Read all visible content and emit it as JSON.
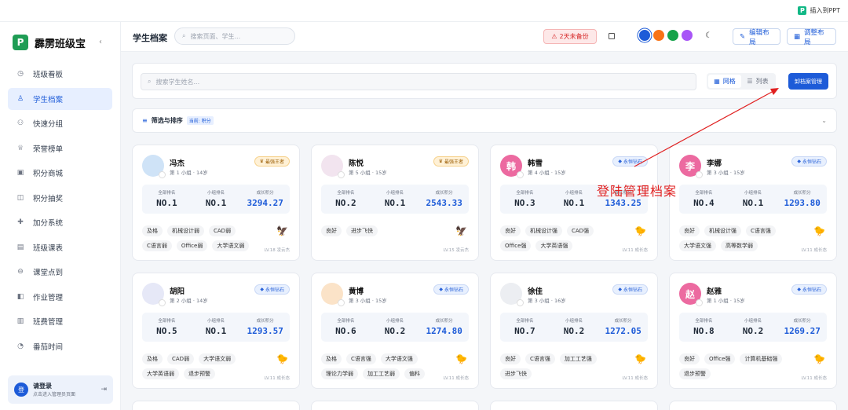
{
  "ppt": {
    "label": "插入到PPT"
  },
  "app": {
    "name": "霹雳班级宝",
    "logo_letter": "P",
    "collapse": "‹"
  },
  "nav": [
    {
      "label": "班级看板",
      "icon": "dashboard-icon",
      "glyph": "◷"
    },
    {
      "label": "学生档案",
      "icon": "user-icon",
      "glyph": "♙",
      "active": true
    },
    {
      "label": "快速分组",
      "icon": "group-icon",
      "glyph": "⚇"
    },
    {
      "label": "荣誉榜单",
      "icon": "trophy-icon",
      "glyph": "♕"
    },
    {
      "label": "积分商城",
      "icon": "shop-icon",
      "glyph": "▣"
    },
    {
      "label": "积分抽奖",
      "icon": "lottery-icon",
      "glyph": "◫"
    },
    {
      "label": "加分系统",
      "icon": "plus-icon",
      "glyph": "✚"
    },
    {
      "label": "班级课表",
      "icon": "calendar-icon",
      "glyph": "▤"
    },
    {
      "label": "课堂点到",
      "icon": "checkin-icon",
      "glyph": "⊖"
    },
    {
      "label": "作业管理",
      "icon": "book-icon",
      "glyph": "◧"
    },
    {
      "label": "班费管理",
      "icon": "wallet-icon",
      "glyph": "▥"
    },
    {
      "label": "番茄时间",
      "icon": "timer-icon",
      "glyph": "◔"
    }
  ],
  "login": {
    "avatar": "登",
    "title": "请登录",
    "sub": "点击进入管理员页面"
  },
  "header": {
    "title": "学生档案",
    "search_placeholder": "搜索页面、学生...",
    "backup": "2天未备份",
    "edit_layout": "编辑布局",
    "adjust_layout": "调整布局"
  },
  "theme_colors": [
    "#1d5bd8",
    "#f97316",
    "#16a34a",
    "#a855f7"
  ],
  "toolbar": {
    "search_placeholder": "搜索学生姓名...",
    "grid": "网格",
    "list": "列表",
    "archive_button": "卸档案管理"
  },
  "filter": {
    "label": "筛选与排序",
    "tag": "当前: 积分"
  },
  "stat_labels": [
    "全部排名",
    "小组排名",
    "成长积分"
  ],
  "annotation": "登陆管理档案",
  "students": [
    {
      "name": "冯杰",
      "sub": "第 1 小组 · 14岁",
      "badge": "最强王者",
      "badge_type": "gold",
      "avatar_color": "#cfe3f7",
      "avatar_text": "",
      "ranks": [
        "NO.1",
        "NO.1",
        "3294.27"
      ],
      "tags": [
        "及格",
        "机械设计弱",
        "CAD弱",
        "C语言弱",
        "Office弱",
        "大学语文弱"
      ],
      "mark": "🦅",
      "level": "LV.18 凌云杰"
    },
    {
      "name": "陈悦",
      "sub": "第 5 小组 · 15岁",
      "badge": "最强王者",
      "badge_type": "gold",
      "avatar_color": "#f2e4ef",
      "avatar_text": "",
      "ranks": [
        "NO.2",
        "NO.1",
        "2543.33"
      ],
      "tags": [
        "良好",
        "进步飞快"
      ],
      "mark": "🦅",
      "level": "LV.15 凌云杰"
    },
    {
      "name": "韩雪",
      "sub": "第 4 小组 · 15岁",
      "badge": "永恒钻石",
      "badge_type": "dia",
      "avatar_color": "#ec6aa0",
      "avatar_text": "韩",
      "ranks": [
        "NO.3",
        "NO.1",
        "1343.25"
      ],
      "tags": [
        "良好",
        "机械设计强",
        "CAD强",
        "Office强",
        "大学英语强"
      ],
      "mark": "🐤",
      "level": "LV.11 成长态"
    },
    {
      "name": "李娜",
      "sub": "第 3 小组 · 15岁",
      "badge": "永恒钻石",
      "badge_type": "dia",
      "avatar_color": "#ec6aa0",
      "avatar_text": "李",
      "ranks": [
        "NO.4",
        "NO.1",
        "1293.80"
      ],
      "tags": [
        "良好",
        "机械设计强",
        "C语言强",
        "大学语文强",
        "高等数学弱"
      ],
      "mark": "🐤",
      "level": "LV.11 成长态"
    },
    {
      "name": "胡阳",
      "sub": "第 2 小组 · 14岁",
      "badge": "永恒钻石",
      "badge_type": "dia",
      "avatar_color": "#e6e8f7",
      "avatar_text": "",
      "ranks": [
        "NO.5",
        "NO.1",
        "1293.57"
      ],
      "tags": [
        "及格",
        "CAD弱",
        "大学语文弱",
        "大学英语弱",
        "退步预警"
      ],
      "mark": "🐤",
      "level": "LV.11 成长态"
    },
    {
      "name": "黄博",
      "sub": "第 3 小组 · 15岁",
      "badge": "永恒钻石",
      "badge_type": "dia",
      "avatar_color": "#fbe3c8",
      "avatar_text": "",
      "ranks": [
        "NO.6",
        "NO.2",
        "1274.80"
      ],
      "tags": [
        "及格",
        "C语言强",
        "大学语文强",
        "理论力学弱",
        "加工工艺弱",
        "偏科"
      ],
      "mark": "🐤",
      "level": "LV.11 成长态"
    },
    {
      "name": "徐佳",
      "sub": "第 3 小组 · 16岁",
      "badge": "永恒钻石",
      "badge_type": "dia",
      "avatar_color": "#eceef2",
      "avatar_text": "",
      "ranks": [
        "NO.7",
        "NO.2",
        "1272.05"
      ],
      "tags": [
        "良好",
        "C语言强",
        "加工工艺强",
        "进步飞快"
      ],
      "mark": "🐤",
      "level": "LV.11 成长态"
    },
    {
      "name": "赵雅",
      "sub": "第 1 小组 · 15岁",
      "badge": "永恒钻石",
      "badge_type": "dia",
      "avatar_color": "#ec6aa0",
      "avatar_text": "赵",
      "ranks": [
        "NO.8",
        "NO.2",
        "1269.27"
      ],
      "tags": [
        "良好",
        "Office强",
        "计算机基础强",
        "退步预警"
      ],
      "mark": "🐤",
      "level": "LV.11 成长态"
    }
  ]
}
